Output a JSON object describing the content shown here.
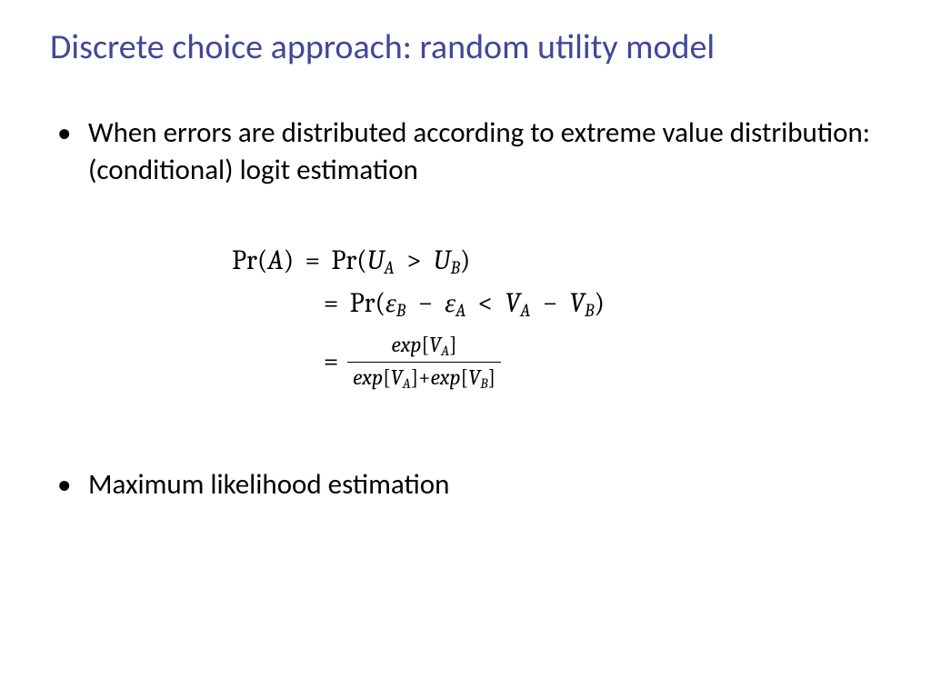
{
  "title": "Discrete choice approach: random utility model",
  "bullets": {
    "b1": "When errors are distributed according to extreme value distribution: (conditional) logit estimation",
    "b2": "Maximum likelihood estimation"
  },
  "math": {
    "lhs_open": "Pr(",
    "A": "A",
    "close": ")",
    "eq": "=",
    "Pr_open": "Pr(",
    "U": "U",
    "subA": "A",
    "gt": ">",
    "subB": "B",
    "eps": "ε",
    "minus": "−",
    "lt": "<",
    "V": "V",
    "exp": "exp",
    "lbr": "[",
    "rbr": "]",
    "plus": "+"
  }
}
